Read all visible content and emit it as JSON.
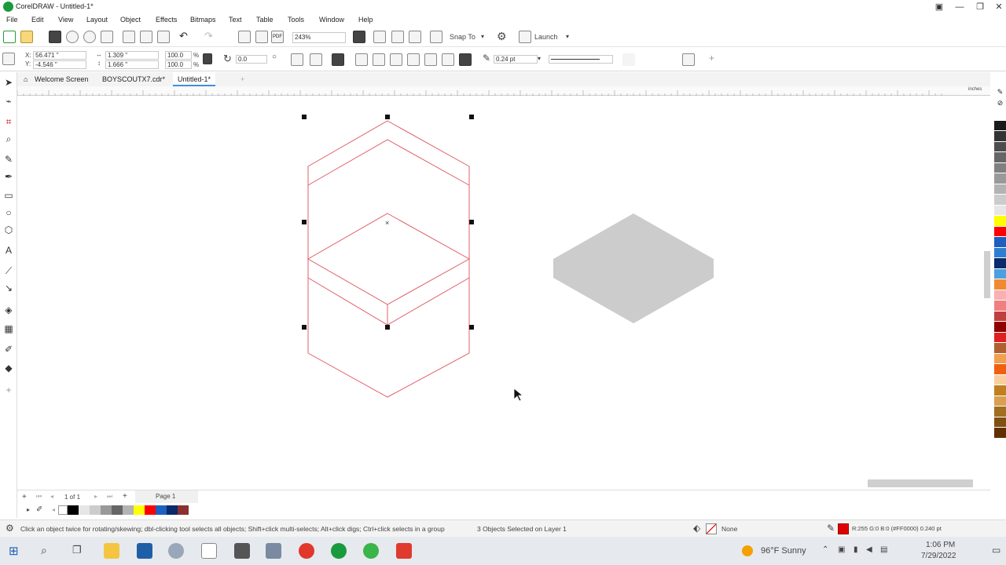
{
  "window": {
    "title": "CorelDRAW - Untitled-1*"
  },
  "menu": [
    "File",
    "Edit",
    "View",
    "Layout",
    "Object",
    "Effects",
    "Bitmaps",
    "Text",
    "Table",
    "Tools",
    "Window",
    "Help"
  ],
  "toolbar": {
    "zoom": "243%",
    "snap_to": "Snap To",
    "launch": "Launch"
  },
  "properties": {
    "x_label": "X:",
    "x": "56.471 \"",
    "y_label": "Y:",
    "y": "-4.546 \"",
    "width": "1.309 \"",
    "height": "1.666 \"",
    "scale_w": "100.0",
    "scale_h": "100.0",
    "percent": "%",
    "rotation": "0.0",
    "outline_width": "0.24 pt"
  },
  "tabs": [
    {
      "label": "Welcome Screen"
    },
    {
      "label": "BOYSCOUTX7.cdr*"
    },
    {
      "label": "Untitled-1*"
    }
  ],
  "ruler": {
    "unit": "inches"
  },
  "page_nav": {
    "page_of": "1 of 1",
    "page_tab": "Page 1"
  },
  "status": {
    "hint": "Click an object twice for rotating/skewing; dbl-clicking tool selects all objects; Shift+click multi-selects; Alt+click digs; Ctrl+click selects in a group",
    "selection": "3 Objects Selected on Layer 1",
    "fill_label": "None",
    "outline_color_info": "R:255 G:0 B:0 (#FF0000)  0.240 pt"
  },
  "taskbar": {
    "weather": "96°F  Sunny",
    "time": "1:06 PM",
    "date": "7/29/2022"
  },
  "colors": {
    "outline_red": "#e0606a",
    "shape_gray": "#cccccc",
    "accent": "#3d8ee0"
  },
  "palette_colors": [
    "#ffffff",
    "#1a1a1a",
    "#333333",
    "#4d4d4d",
    "#666666",
    "#808080",
    "#999999",
    "#b3b3b3",
    "#cccccc",
    "#e6e6e6",
    "#ffff00",
    "#ff0000",
    "#1f5fbf",
    "#2f7fd0",
    "#0a2a6a",
    "#4aa0e0",
    "#f08a30",
    "#f8b0b0",
    "#f08080",
    "#c04040",
    "#900000",
    "#e02020",
    "#b06030",
    "#f0a050",
    "#f06010",
    "#f8d0a0",
    "#c08020",
    "#d8a050",
    "#a07020",
    "#805010",
    "#603000"
  ],
  "doc_palette_colors": [
    "#000000",
    "#e6e6e6",
    "#cccccc",
    "#999999",
    "#666666",
    "#b3b3b3",
    "#ffff00",
    "#ff0000",
    "#1f5fbf",
    "#0a2a6a",
    "#8a3030"
  ]
}
